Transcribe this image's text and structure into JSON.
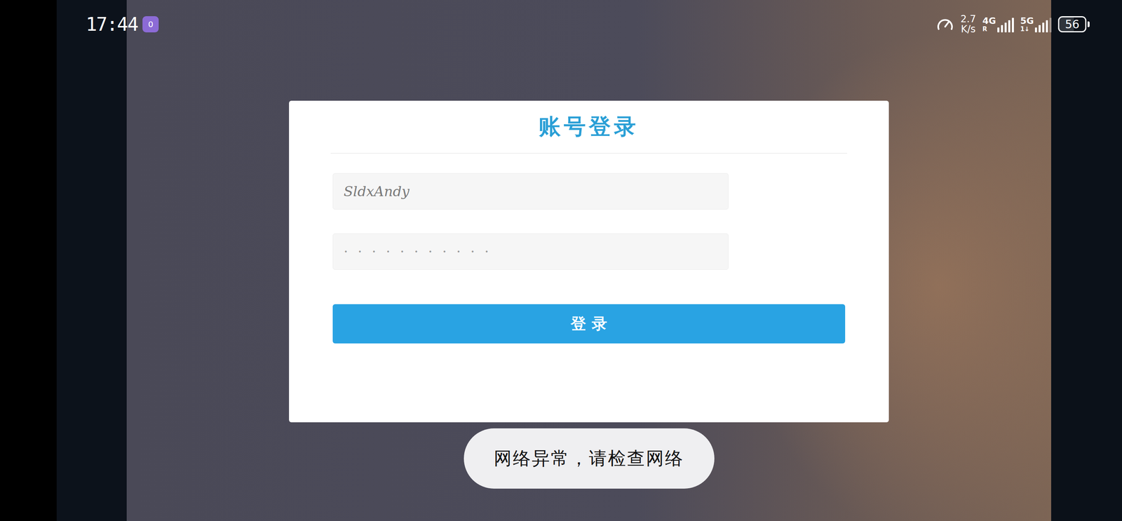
{
  "status_bar": {
    "time": "17:44",
    "notification_badge": "0",
    "speed": "2.7",
    "speed_unit": "K/s",
    "networks": [
      {
        "label": "4G",
        "sub": "R",
        "level": 1
      },
      {
        "label": "5G",
        "sub": "1↓",
        "level": 0.8
      }
    ],
    "battery": "56",
    "battery_level": 0.56
  },
  "login": {
    "title": "账号登录",
    "username": "SldxAndy",
    "password": "···········",
    "button": "登 录"
  },
  "toast": "网络异常，请检查网络"
}
